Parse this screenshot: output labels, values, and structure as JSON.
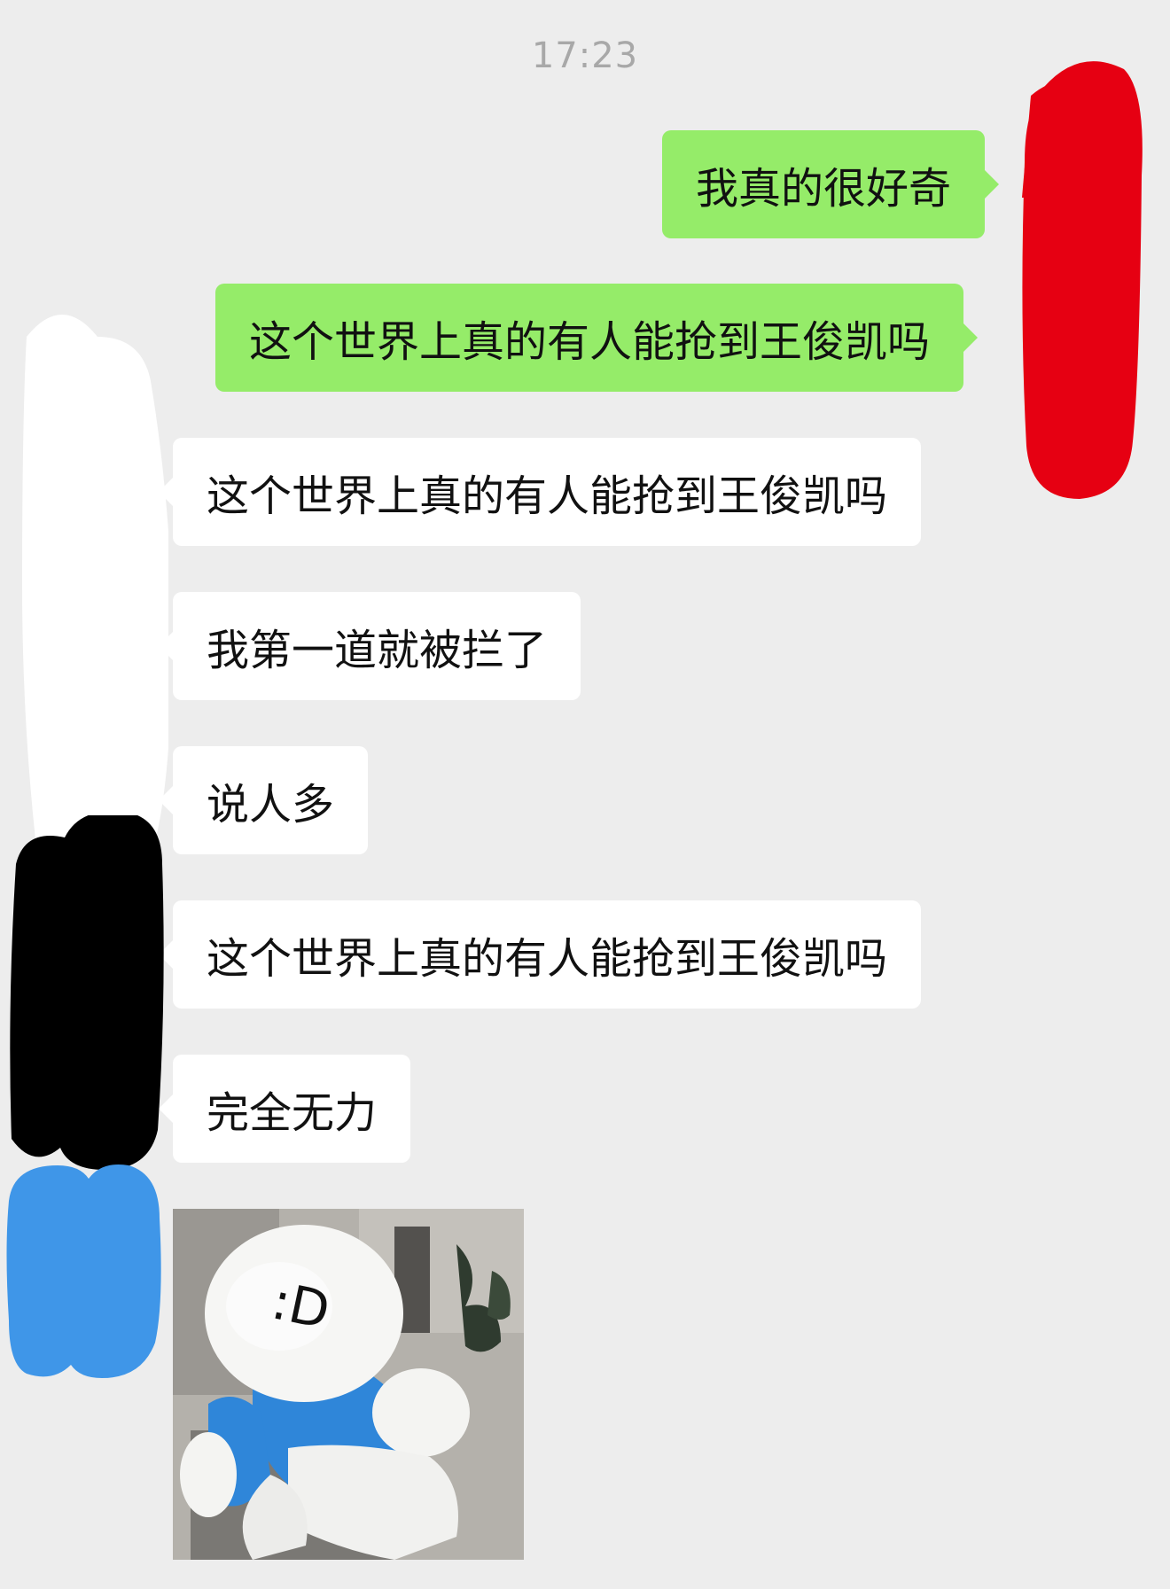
{
  "chat": {
    "timestamp": "17:23",
    "messages": [
      {
        "side": "out",
        "text": "我真的很好奇"
      },
      {
        "side": "out",
        "text": "这个世界上真的有人能抢到王俊凯吗"
      },
      {
        "side": "in",
        "text": "这个世界上真的有人能抢到王俊凯吗"
      },
      {
        "side": "in",
        "text": "我第一道就被拦了"
      },
      {
        "side": "in",
        "text": "说人多"
      },
      {
        "side": "in",
        "text": "这个世界上真的有人能抢到王俊凯吗"
      },
      {
        "side": "in",
        "text": "完全无力"
      }
    ],
    "sticker": {
      "face_text": ":D",
      "description": "white plush doll with blue shirt"
    }
  },
  "colors": {
    "background": "#ededed",
    "outgoing_bubble": "#95ec69",
    "incoming_bubble": "#ffffff",
    "timestamp": "#a8a8a8",
    "redaction_red": "#e60012",
    "redaction_white": "#ffffff",
    "redaction_black": "#000000",
    "redaction_blue": "#3f96e8"
  }
}
